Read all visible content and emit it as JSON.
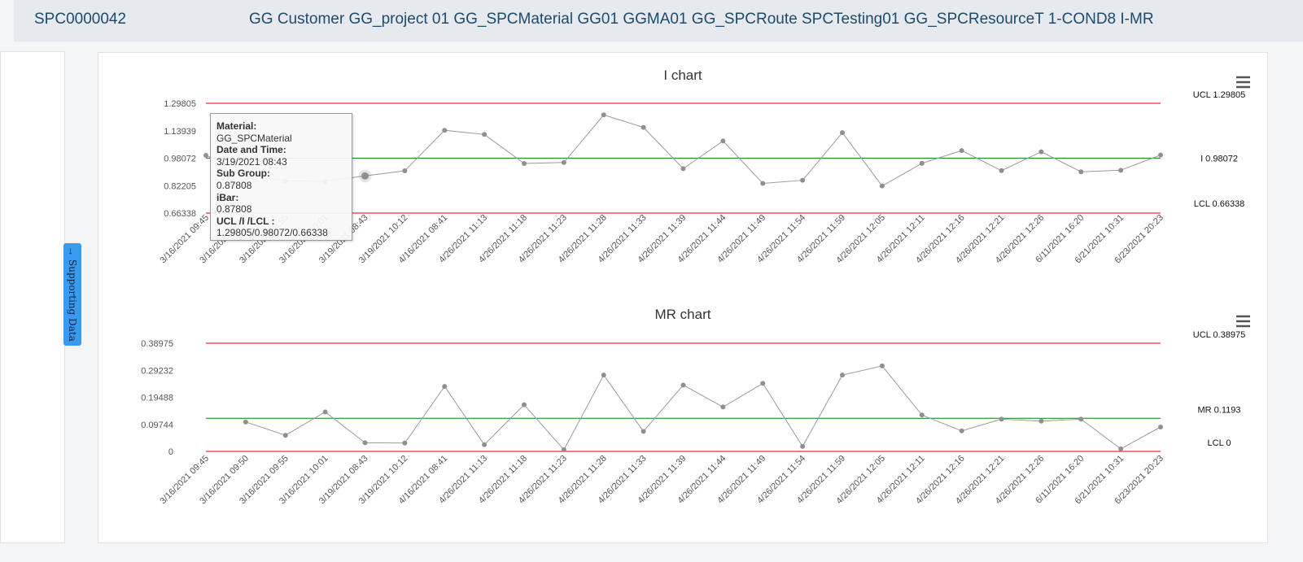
{
  "header": {
    "code": "SPC0000042",
    "title": "GG Customer GG_project 01 GG_SPCMaterial GG01 GGMA01 GG_SPCRoute SPCTesting01 GG_SPCResourceT 1-COND8 I-MR"
  },
  "side_tab": {
    "label": "Supporting Data",
    "arrow": "→"
  },
  "tooltip": {
    "material_label": "Material:",
    "material_value": "GG_SPCMaterial",
    "datetime_label": "Date and Time:",
    "datetime_value": "3/19/2021 08:43",
    "subgroup_label": "Sub Group:",
    "subgroup_value": "0.87808",
    "ibar_label": "iBar:",
    "ibar_value": "0.87808",
    "limits_label": "UCL /I /LCL :",
    "limits_value": "1.29805/0.98072/0.66338"
  },
  "colors": {
    "control_limit": "#e8303a",
    "center_line": "#2e8b2e",
    "series_line": "#9a9a9a",
    "series_point": "#8f8f8f"
  },
  "chart_data": [
    {
      "type": "line",
      "title": "I chart",
      "categories": [
        "3/16/2021 09:45",
        "3/16/2021 09:50",
        "3/16/2021 09:55",
        "3/16/2021 10:01",
        "3/19/2021 08:43",
        "3/19/2021 10:12",
        "4/16/2021 08:41",
        "4/26/2021 11:13",
        "4/26/2021 11:18",
        "4/26/2021 11:23",
        "4/26/2021 11:28",
        "4/26/2021 11:33",
        "4/26/2021 11:39",
        "4/26/2021 11:44",
        "4/26/2021 11:49",
        "4/26/2021 11:54",
        "4/26/2021 11:59",
        "4/26/2021 12:05",
        "4/26/2021 12:11",
        "4/26/2021 12:16",
        "4/26/2021 12:21",
        "4/26/2021 12:26",
        "6/11/2021 16:20",
        "6/21/2021 10:31",
        "6/23/2021 20:23"
      ],
      "values": [
        0.997,
        0.891,
        0.849,
        0.847,
        0.878,
        0.908,
        1.142,
        1.118,
        0.95,
        0.956,
        1.231,
        1.159,
        0.92,
        1.08,
        0.835,
        0.853,
        1.128,
        0.82,
        0.951,
        1.025,
        0.909,
        1.018,
        0.902,
        0.911,
        0.999
      ],
      "yticks": [
        "1.29805",
        "1.13939",
        "0.98072",
        "0.82205",
        "0.66338"
      ],
      "ylim": [
        0.66338,
        1.29805
      ],
      "control_lines": [
        {
          "label": "UCL 1.29805",
          "value": 1.29805,
          "kind": "limit"
        },
        {
          "label": "I 0.98072",
          "value": 0.98072,
          "kind": "center"
        },
        {
          "label": "LCL 0.66338",
          "value": 0.66338,
          "kind": "limit"
        }
      ],
      "highlight_index": 4
    },
    {
      "type": "line",
      "title": "MR chart",
      "categories": [
        "3/16/2021 09:45",
        "3/16/2021 09:50",
        "3/16/2021 09:55",
        "3/16/2021 10:01",
        "3/19/2021 08:43",
        "3/19/2021 10:12",
        "4/16/2021 08:41",
        "4/26/2021 11:13",
        "4/26/2021 11:18",
        "4/26/2021 11:23",
        "4/26/2021 11:28",
        "4/26/2021 11:33",
        "4/26/2021 11:39",
        "4/26/2021 11:44",
        "4/26/2021 11:49",
        "4/26/2021 11:54",
        "4/26/2021 11:59",
        "4/26/2021 12:05",
        "4/26/2021 12:11",
        "4/26/2021 12:16",
        "4/26/2021 12:21",
        "4/26/2021 12:26",
        "6/11/2021 16:20",
        "6/21/2021 10:31",
        "6/23/2021 20:23"
      ],
      "values": [
        null,
        0.106,
        0.058,
        0.142,
        0.031,
        0.03,
        0.234,
        0.024,
        0.168,
        0.006,
        0.275,
        0.072,
        0.239,
        0.16,
        0.245,
        0.018,
        0.275,
        0.308,
        0.131,
        0.074,
        0.116,
        0.109,
        0.116,
        0.009,
        0.088
      ],
      "yticks": [
        "0.38975",
        "0.29232",
        "0.19488",
        "0.09744",
        "0"
      ],
      "ylim": [
        0,
        0.38975
      ],
      "control_lines": [
        {
          "label": "UCL 0.38975",
          "value": 0.38975,
          "kind": "limit"
        },
        {
          "label": "MR 0.1193",
          "value": 0.1193,
          "kind": "center"
        },
        {
          "label": "LCL 0",
          "value": 0,
          "kind": "limit"
        }
      ]
    }
  ]
}
